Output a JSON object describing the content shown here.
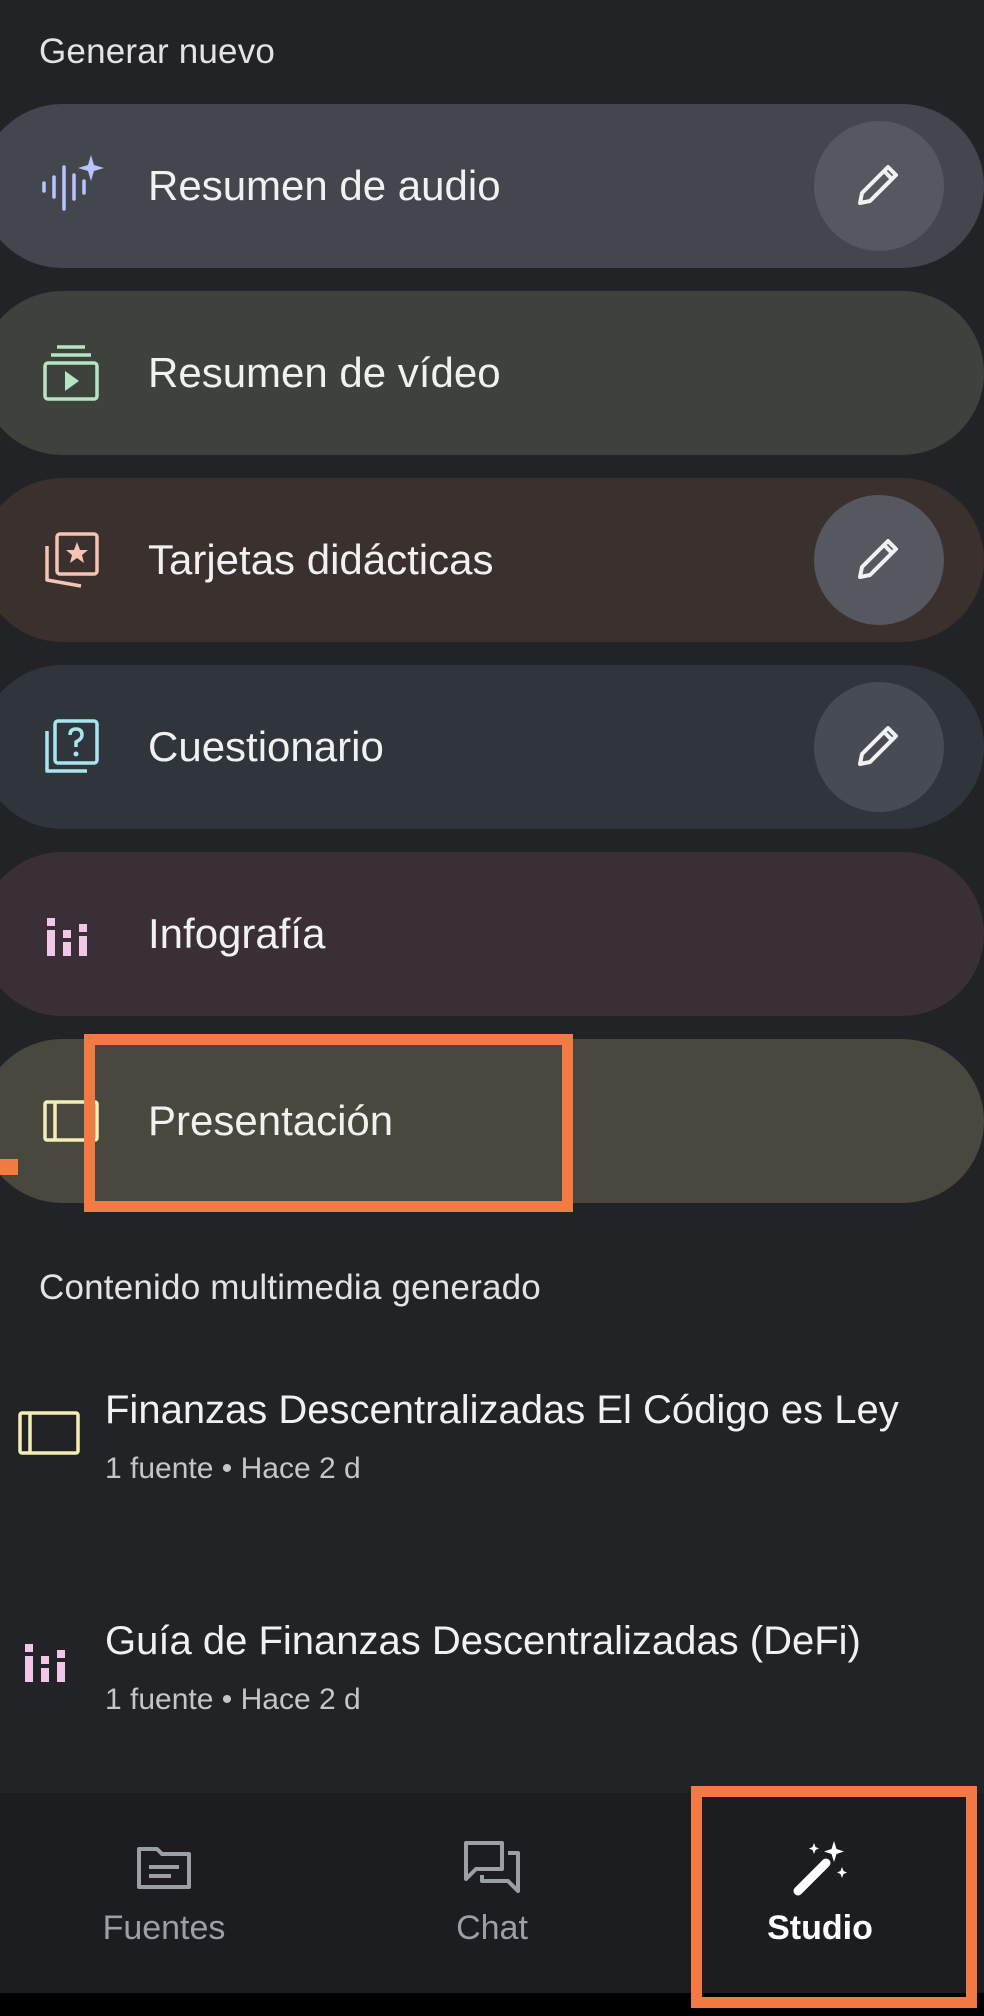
{
  "sections": {
    "generate_title": "Generar nuevo",
    "media_title": "Contenido multimedia generado"
  },
  "generate_items": [
    {
      "label": "Resumen de audio",
      "icon": "audio-sparkle-icon",
      "color": "#44464e",
      "icon_color": "#b8c4ff",
      "editable": true
    },
    {
      "label": "Resumen de vídeo",
      "icon": "video-play-icon",
      "color": "#3d423c",
      "icon_color": "#b7e4c7",
      "editable": false
    },
    {
      "label": "Tarjetas didácticas",
      "icon": "flashcards-star-icon",
      "color": "#3a302d",
      "icon_color": "#f5c4b3",
      "editable": true
    },
    {
      "label": "Cuestionario",
      "icon": "quiz-question-icon",
      "color": "#30353c",
      "icon_color": "#a8e6ef",
      "editable": true
    },
    {
      "label": "Infografía",
      "icon": "infographic-bars-icon",
      "color": "#3a2f37",
      "icon_color": "#f2c6e8",
      "editable": false
    },
    {
      "label": "Presentación",
      "icon": "slides-icon",
      "color": "#48483e",
      "icon_color": "#f3efb3",
      "editable": false
    }
  ],
  "media_items": [
    {
      "title": "Finanzas Descentralizadas El Código es Ley",
      "meta": "1 fuente • Hace 2 d",
      "icon": "slides-icon",
      "icon_color": "#f3efb3"
    },
    {
      "title": "Guía de Finanzas Descentralizadas (DeFi)",
      "meta": "1 fuente • Hace 2 d",
      "icon": "infographic-bars-icon",
      "icon_color": "#f2c6e8"
    }
  ],
  "nav": {
    "items": [
      {
        "label": "Fuentes",
        "icon": "sources-icon",
        "active": false
      },
      {
        "label": "Chat",
        "icon": "chat-icon",
        "active": false
      },
      {
        "label": "Studio",
        "icon": "magic-wand-icon",
        "active": true
      }
    ]
  },
  "colors": {
    "background": "#212327",
    "highlight": "#f47a43",
    "edit_button": "#55585f"
  }
}
